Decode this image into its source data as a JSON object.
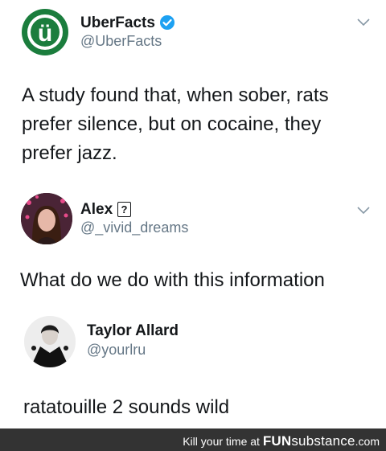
{
  "tweet1": {
    "name": "UberFacts",
    "handle": "@UberFacts",
    "avatar_letter": "ü",
    "text": "A study found that, when sober, rats prefer silence, but on cocaine, they prefer jazz."
  },
  "tweet2": {
    "name": "Alex",
    "badge": "?",
    "handle": "@_vivid_dreams",
    "text": "What do we do with this information"
  },
  "tweet3": {
    "name": "Taylor Allard",
    "handle": "@yourlru",
    "text": "ratatouille 2 sounds wild"
  },
  "footer": {
    "prefix": "Kill your time at ",
    "brand_bold": "FUN",
    "brand_light": "substance",
    "suffix": ".com"
  },
  "colors": {
    "uberfacts_green": "#1b7d3d",
    "verified_blue": "#1da1f2",
    "handle_gray": "#657786"
  }
}
